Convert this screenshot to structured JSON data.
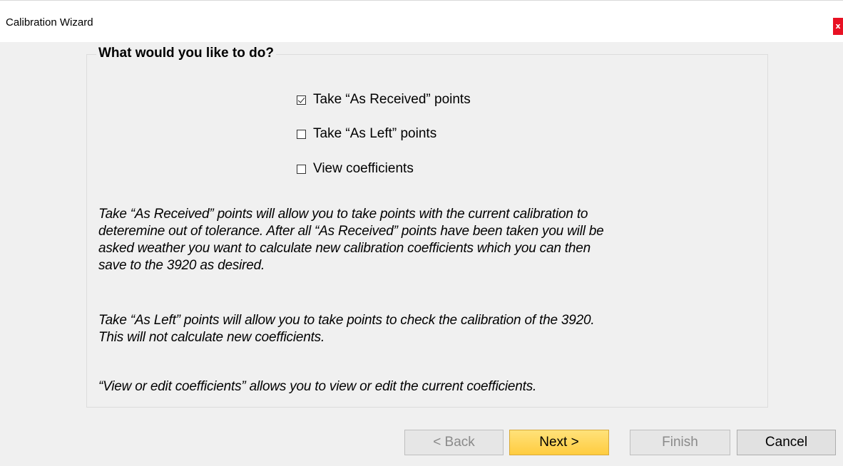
{
  "window": {
    "title": "Calibration Wizard",
    "close_label": "x"
  },
  "group": {
    "legend": "What would you like to do?"
  },
  "options": [
    {
      "label": "Take “As Received” points",
      "checked": true
    },
    {
      "label": "Take “As Left” points",
      "checked": false
    },
    {
      "label": "View coefficients",
      "checked": false
    }
  ],
  "description": {
    "para1_line1": "Take “As Received” points will allow you to take points with the current calibration to",
    "para1_line2": "deteremine out of tolerance.  After all “As Received” points have been taken you will be",
    "para1_line3": "asked weather you want to calculate new calibration coefficients which you can then",
    "para1_line4": "save to the 3920 as desired.",
    "para2_line1": "Take “As Left” points will allow you to take points to check the calibration of the 3920.",
    "para2_line2": "This will not calculate new coefficients.",
    "para3_line1": "“View or edit coefficients” allows you to view or edit the current coefficients."
  },
  "buttons": {
    "back": "< Back",
    "next": "Next >",
    "finish": "Finish",
    "cancel": "Cancel"
  },
  "colors": {
    "close_bg": "#e81123",
    "next_bg": "#ffcc40",
    "window_bg": "#f0f0f0"
  }
}
